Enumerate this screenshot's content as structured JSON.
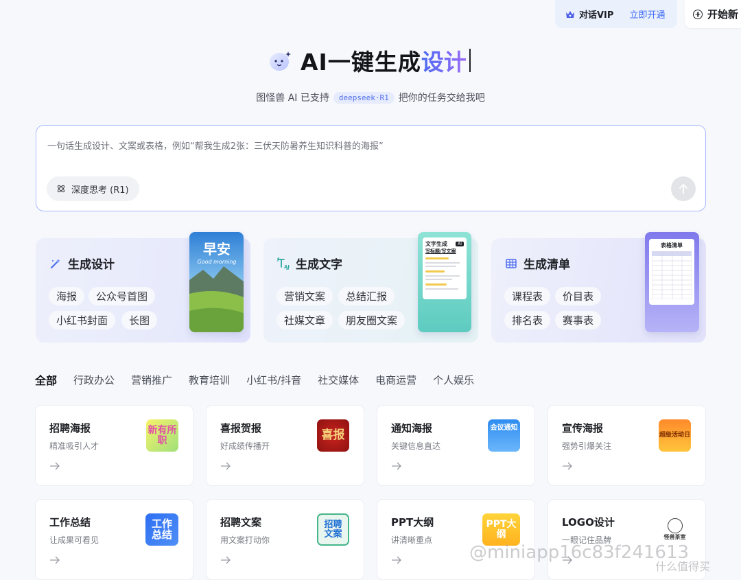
{
  "topbar": {
    "vip_label": "对话VIP",
    "vip_open": "立即开通",
    "new_label": "开始新"
  },
  "hero": {
    "title": "AI一键生成",
    "accent": "设计",
    "sub_before": "图怪兽 AI 已支持",
    "badge": "deepseek·R1",
    "sub_after": "把你的任务交给我吧"
  },
  "input": {
    "placeholder": "一句话生成设计、文案或表格，例如“帮我生成2张：三伏天防暑养生知识科普的海报”",
    "deep_think": "深度思考 (R1)"
  },
  "features": [
    {
      "title": "生成设计",
      "chips": [
        "海报",
        "公众号首图",
        "小红书封面",
        "长图"
      ],
      "thumb_text": "早安",
      "thumb_sub": "Good morning"
    },
    {
      "title": "生成文字",
      "chips": [
        "营销文案",
        "总结汇报",
        "社媒文章",
        "朋友圈文案"
      ],
      "thumb_title": "文字生成",
      "thumb_sub": "写标题/写文案",
      "thumb_badge": "AI"
    },
    {
      "title": "生成清单",
      "chips": [
        "课程表",
        "价目表",
        "排名表",
        "赛事表"
      ],
      "thumb_title": "表格清单"
    }
  ],
  "tabs": [
    "全部",
    "行政办公",
    "营销推广",
    "教育培训",
    "小红书/抖音",
    "社交媒体",
    "电商运营",
    "个人娱乐"
  ],
  "templates": [
    {
      "title": "招聘海报",
      "sub": "精准吸引人才",
      "icon_text": "新有所职",
      "icon": "recruit-poster-icon"
    },
    {
      "title": "喜报贺报",
      "sub": "好成绩传播开",
      "icon_text": "喜报",
      "icon": "good-news-icon"
    },
    {
      "title": "通知海报",
      "sub": "关键信息直达",
      "icon_text": "会议通知",
      "icon": "notice-icon"
    },
    {
      "title": "宣传海报",
      "sub": "强势引爆关注",
      "icon_text": "超级活动日",
      "icon": "promo-icon"
    },
    {
      "title": "工作总结",
      "sub": "让成果可看见",
      "icon_text": "工作总结",
      "icon": "work-summary-icon"
    },
    {
      "title": "招聘文案",
      "sub": "用文案打动你",
      "icon_text": "招聘文案",
      "icon": "recruit-copy-icon"
    },
    {
      "title": "PPT大纲",
      "sub": "讲清晰重点",
      "icon_text": "PPT大纲",
      "icon": "ppt-outline-icon"
    },
    {
      "title": "LOGO设计",
      "sub": "一眼记住品牌",
      "icon_text": "怪兽茶室",
      "icon": "logo-design-icon"
    }
  ],
  "watermark": "@miniapp16c83f241613",
  "corner_mark": "什么值得买",
  "colors": {
    "accent": "#3f6cf6",
    "input_border": "#aab9ff",
    "background": "#f6f8fc"
  }
}
